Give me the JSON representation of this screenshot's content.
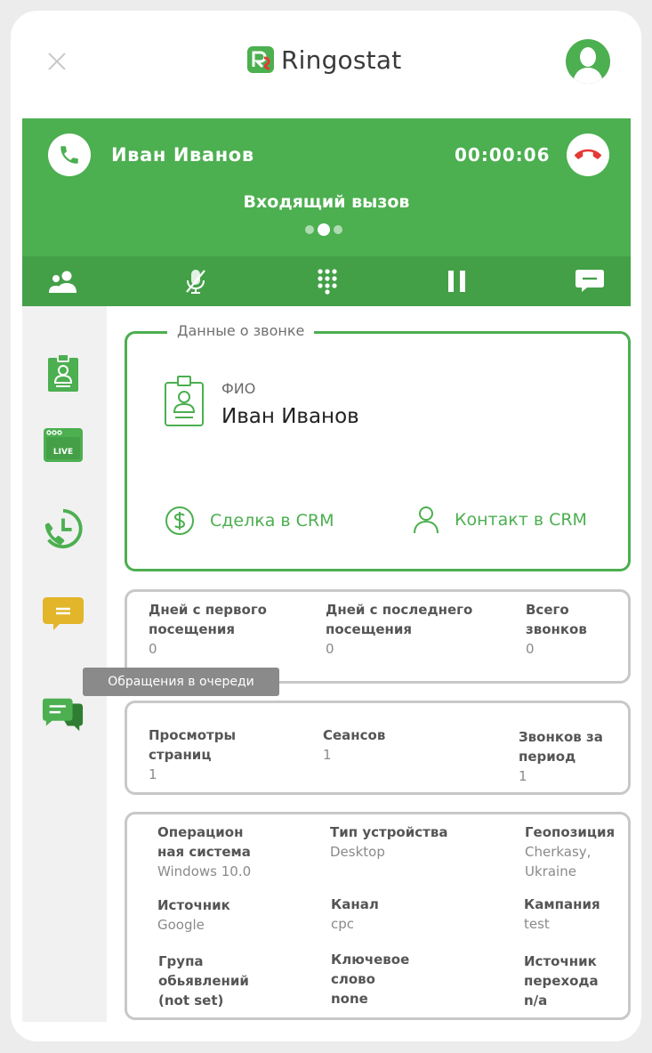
{
  "app": {
    "brand": "Ringostat"
  },
  "call": {
    "caller": "Иван Иванов",
    "timer": "00:00:06",
    "status": "Входящий вызов",
    "pager_active": 1,
    "pager_count": 3
  },
  "tooltip": "Обращения в очереди",
  "call_data": {
    "legend": "Данные о звонке",
    "fio_label": "ФИО",
    "fio_value": "Иван Иванов",
    "deal_crm": "Сделка в CRM",
    "contact_crm": "Контакт в CRM"
  },
  "stats1": [
    {
      "key": "Дней с первого посещения",
      "value": "0"
    },
    {
      "key": "Дней с последнего посещения",
      "value": "0"
    },
    {
      "key": "Всего звонков",
      "value": "0"
    }
  ],
  "stats2": [
    {
      "key": "Просмотры страниц",
      "value": "1"
    },
    {
      "key": "Сеансов",
      "value": "1"
    },
    {
      "key": "Звонков за период",
      "value": "1"
    }
  ],
  "details": [
    {
      "key": "Операцион ная система",
      "value": "Windows 10.0"
    },
    {
      "key": "Тип устройства",
      "value": "Desktop"
    },
    {
      "key": "Геопозиция",
      "value": "Cherkasy, Ukraine"
    },
    {
      "key": "Источник",
      "value": "Google"
    },
    {
      "key": "Канал",
      "value": "cpc"
    },
    {
      "key": "Кампания",
      "value": "test"
    },
    {
      "key": "Група обьявлений",
      "value": "(not set)"
    },
    {
      "key": "Ключевое слово",
      "value": "none"
    },
    {
      "key": "Источник перехода",
      "value": "n/a"
    }
  ],
  "sidebar_icon": "live-label",
  "colors": {
    "accent": "#4caf50",
    "accent_dark": "#43a047",
    "hangup": "#e53935",
    "chat_yellow": "#e2b52a"
  },
  "icons": [
    "close-icon",
    "ringostat-logo",
    "user-avatar-icon",
    "phone-icon",
    "hangup-icon",
    "transfer-icon",
    "mic-off-icon",
    "dialpad-icon",
    "pause-icon",
    "chat-icon",
    "contact-card-icon",
    "live-icon",
    "history-icon",
    "message-icon",
    "queue-icon",
    "dollar-icon",
    "person-icon"
  ]
}
